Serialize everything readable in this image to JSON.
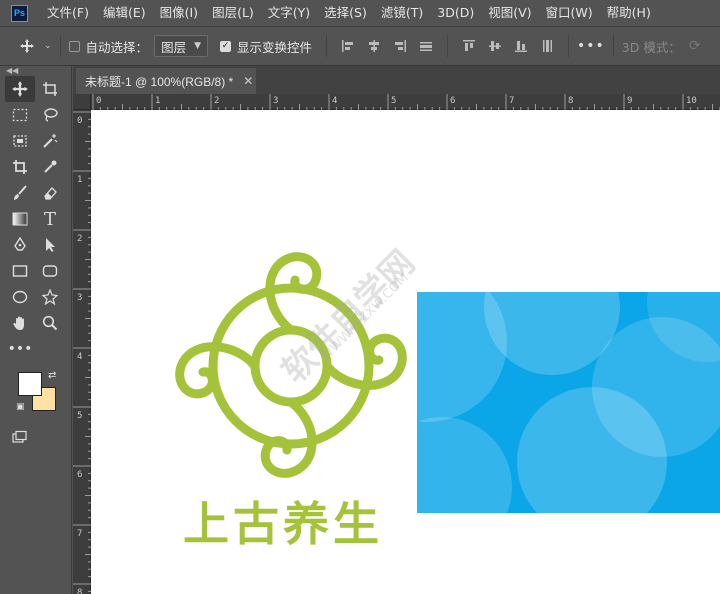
{
  "app": {
    "logo_text": "Ps"
  },
  "menu": [
    "文件(F)",
    "编辑(E)",
    "图像(I)",
    "图层(L)",
    "文字(Y)",
    "选择(S)",
    "滤镜(T)",
    "3D(D)",
    "视图(V)",
    "窗口(W)",
    "帮助(H)"
  ],
  "options": {
    "auto_select_label": "自动选择：",
    "auto_select_target": "图层",
    "show_transform_label": "显示变换控件",
    "mode_3d_label": "3D 模式："
  },
  "document": {
    "tab_title": "未标题-1 @ 100%(RGB/8) *",
    "ruler_top_numbers": [
      "0",
      "1",
      "2",
      "3",
      "4",
      "5",
      "6",
      "7",
      "8",
      "9",
      "10"
    ],
    "ruler_left_numbers": [
      "0",
      "1",
      "2",
      "3",
      "4",
      "5",
      "6",
      "7",
      "8"
    ]
  },
  "canvas": {
    "brand_text": "上古养生",
    "watermark_text": "软件自学网",
    "watermark_url": "WWW.RJZXW.COM"
  },
  "colors": {
    "foreground": "#ffffff",
    "background": "#ffe1a4",
    "logo_green": "#a4c23a",
    "image_blue": "#0aa6e8"
  }
}
